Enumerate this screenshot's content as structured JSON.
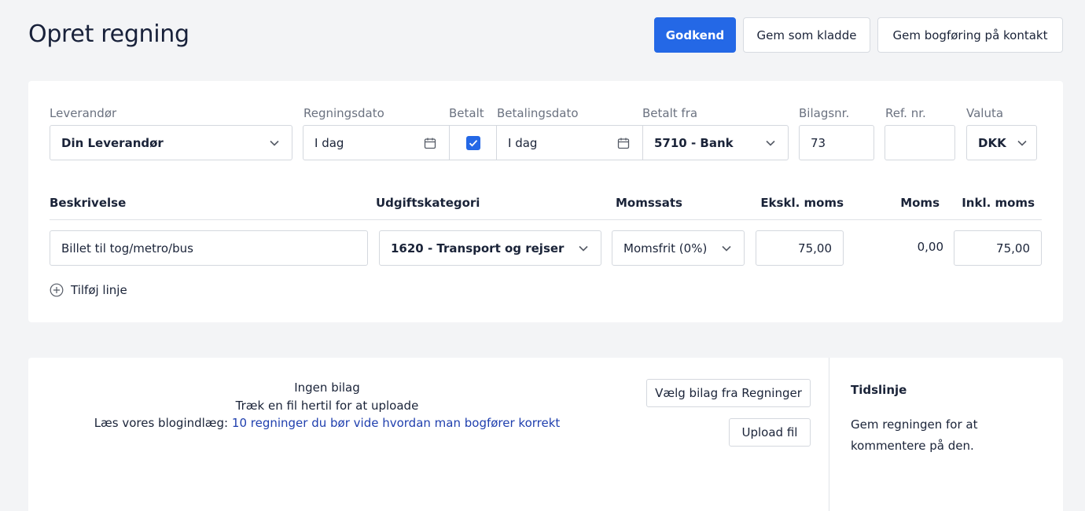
{
  "header": {
    "title": "Opret regning",
    "approve_label": "Godkend",
    "save_draft_label": "Gem som kladde",
    "save_contact_label": "Gem bogføring på kontakt"
  },
  "bill": {
    "supplier_label": "Leverandør",
    "supplier_value": "Din Leverandør",
    "bill_date_label": "Regningsdato",
    "bill_date_value": "I dag",
    "paid_label": "Betalt",
    "paid_checked": true,
    "payment_date_label": "Betalingsdato",
    "payment_date_value": "I dag",
    "paid_from_label": "Betalt fra",
    "paid_from_value": "5710 - Bank",
    "voucher_label": "Bilagsnr.",
    "voucher_value": "73",
    "ref_label": "Ref. nr.",
    "ref_value": "",
    "currency_label": "Valuta",
    "currency_value": "DKK"
  },
  "lines": {
    "headers": {
      "description": "Beskrivelse",
      "category": "Udgiftskategori",
      "vat_rate": "Momssats",
      "excl": "Ekskl. moms",
      "vat": "Moms",
      "incl": "Inkl. moms"
    },
    "rows": [
      {
        "description": "Billet til tog/metro/bus",
        "category": "1620 - Transport og rejser",
        "vat_rate": "Momsfrit (0%)",
        "excl": "75,00",
        "vat": "0,00",
        "incl": "75,00"
      }
    ],
    "add_line_label": "Tilføj linje"
  },
  "attachment": {
    "no_attachment": "Ingen bilag",
    "drag_hint": "Træk en fil hertil for at uploade",
    "blog_prefix": "Læs vores blogindlæg:",
    "blog_link": "10 regninger du bør vide hvordan man bogfører korrekt",
    "choose_button": "Vælg bilag fra Regninger",
    "upload_button": "Upload fil"
  },
  "timeline": {
    "title": "Tidslinje",
    "text": "Gem regningen for at kommentere på den."
  },
  "colors": {
    "primary": "#2468e6",
    "link": "#1f3fae"
  }
}
